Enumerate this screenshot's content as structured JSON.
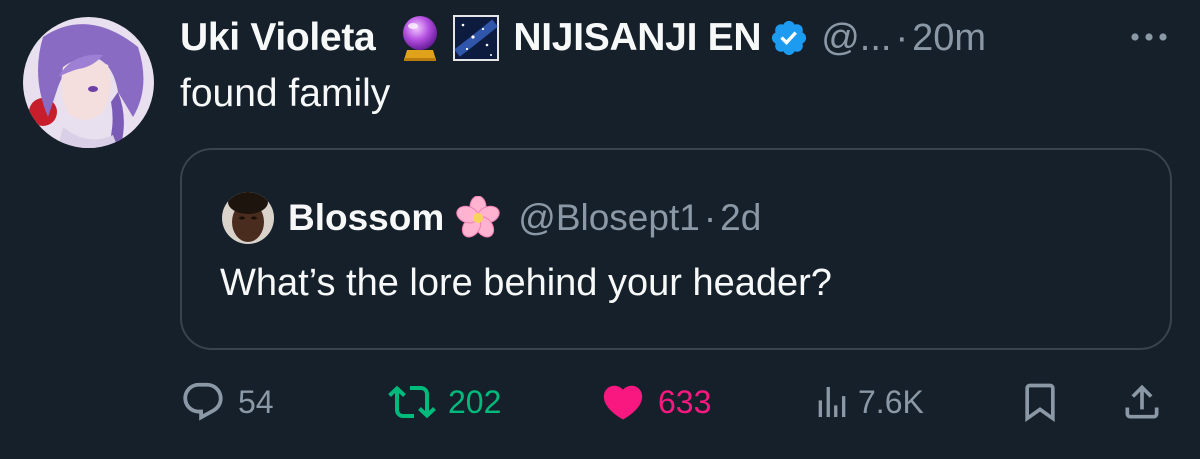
{
  "author": {
    "display_name": "Uki Violeta",
    "org_name": "NIJISANJI EN",
    "handle": "@...",
    "time": "20m",
    "dot": "·",
    "verified": true,
    "emojis": [
      "crystal-ball-emoji",
      "milky-way-emoji"
    ]
  },
  "tweet": {
    "text": "found family"
  },
  "quote": {
    "display_name": "Blossom",
    "emoji": "cherry-blossom-emoji",
    "handle": "@Blosept1",
    "dot": "·",
    "time": "2d",
    "text": "What’s the lore behind your header?"
  },
  "actions": {
    "replies": "54",
    "retweets": "202",
    "likes": "633",
    "views": "7.6K"
  },
  "colors": {
    "background": "#15202b",
    "primary_text": "#f7f9f9",
    "secondary_text": "#8b98a5",
    "border": "#38444d",
    "verified": "#1d9bf0",
    "retweet": "#00ba7c",
    "like": "#f91880"
  }
}
